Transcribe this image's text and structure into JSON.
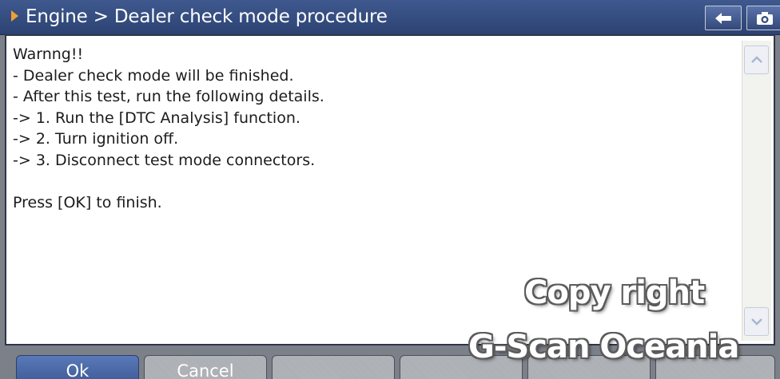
{
  "titlebar": {
    "title": "Engine > Dealer check mode procedure",
    "back_icon": "back-arrow-icon",
    "camera_icon": "camera-icon"
  },
  "message": {
    "lines": [
      "Warnng!!",
      "- Dealer check mode will be finished.",
      "- After this test, run the following details.",
      "-> 1. Run the [DTC Analysis] function.",
      "-> 2. Turn ignition off.",
      "-> 3. Disconnect test mode connectors.",
      "",
      "Press [OK] to finish."
    ]
  },
  "buttons": {
    "ok_label": "Ok",
    "cancel_label": "Cancel"
  },
  "watermark": {
    "line1": "Copy right",
    "line2": "G-Scan Oceania"
  },
  "colors": {
    "titlebar": "#34497a",
    "accent_arrow": "#f0a030",
    "active_button": "#4a68a6",
    "inactive_button": "#aeb1b6"
  }
}
